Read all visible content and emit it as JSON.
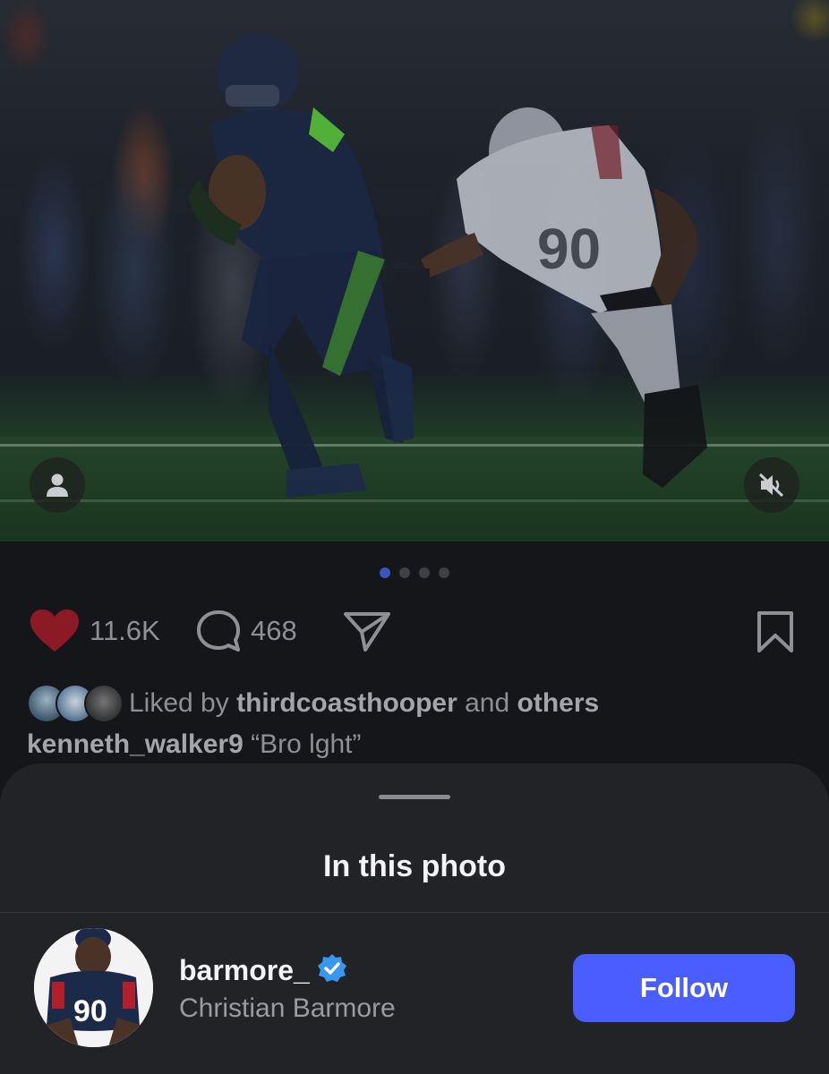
{
  "post": {
    "likes_count": "11.6K",
    "comments_count": "468",
    "carousel": {
      "total": 4,
      "active": 1
    },
    "liked_by": {
      "prefix": "Liked by",
      "user": "thirdcoasthooper",
      "connector": "and",
      "suffix": "others"
    },
    "caption": {
      "username": "kenneth_walker9",
      "text": "“Bro lght”"
    }
  },
  "icons": {
    "user": "person-icon",
    "mute": "speaker-muted-icon",
    "like": "heart-filled-icon",
    "comment": "speech-bubble-icon",
    "share": "paper-plane-icon",
    "save": "bookmark-icon",
    "verified": "verified-badge-icon"
  },
  "sheet": {
    "title": "In this photo",
    "tagged_user": {
      "username": "barmore_",
      "full_name": "Christian Barmore",
      "verified": true,
      "follow_label": "Follow"
    }
  },
  "colors": {
    "like_red": "#8b1a24",
    "follow_blue": "#4a5dff",
    "verified_blue": "#3897f0",
    "active_dot": "#3a56b8"
  }
}
